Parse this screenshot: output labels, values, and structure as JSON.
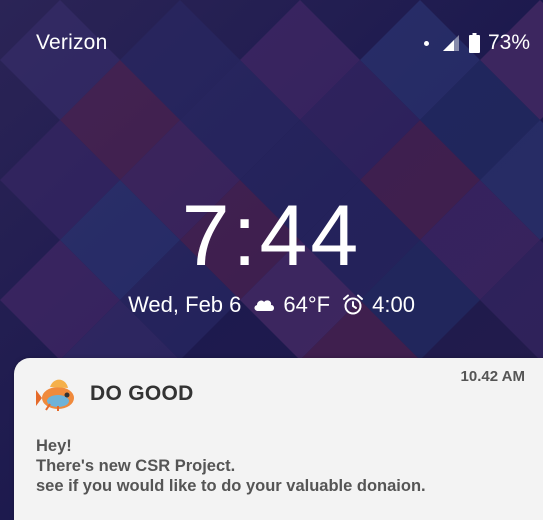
{
  "status_bar": {
    "carrier": "Verizon",
    "battery_percent": "73%",
    "icons": [
      "notification-dot-icon",
      "signal-icon",
      "battery-icon"
    ]
  },
  "lockscreen": {
    "time": "7:44",
    "date": "Wed, Feb 6",
    "weather_icon": "cloud-icon",
    "temperature": "64°F",
    "alarm_icon": "alarm-clock-icon",
    "alarm_time": "4:00"
  },
  "notification": {
    "time": "10.42 AM",
    "app_icon": "fish-logo-icon",
    "app_name": "DO GOOD",
    "lines": [
      "Hey!",
      "There's new CSR Project.",
      "see if you would like to do your valuable donaion."
    ]
  },
  "colors": {
    "wallpaper_base": "#1d1a4e",
    "wallpaper_purple": "#4a2a6c",
    "wallpaper_magenta": "#5a2450",
    "notification_bg": "#f3f3f3",
    "text_white": "#ffffff",
    "notification_text": "#555555"
  }
}
